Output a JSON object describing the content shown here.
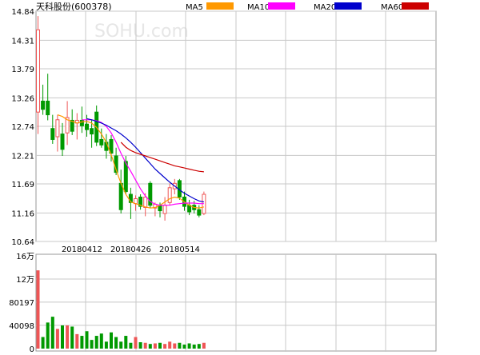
{
  "header": {
    "title": "天科股份(600378)",
    "watermark": "SOHU.com"
  },
  "colors": {
    "up": "#ee5555",
    "down": "#009900",
    "grid": "#c8c8c8",
    "frame": "#999999"
  },
  "chart_data": [
    {
      "type": "candlestick",
      "title": "天科股份(600378)",
      "ylim": [
        10.64,
        14.84
      ],
      "yticks": [
        "14.84",
        "14.31",
        "13.79",
        "13.26",
        "12.74",
        "12.21",
        "11.69",
        "11.16",
        "10.64"
      ],
      "xticks": [
        {
          "index": 9,
          "label": "20180412"
        },
        {
          "index": 19,
          "label": "20180426"
        },
        {
          "index": 29,
          "label": "20180514"
        }
      ],
      "grid": true,
      "legend_position": "top",
      "ma_series": [
        {
          "name": "MA5",
          "color": "#ff9900",
          "values": [
            null,
            null,
            null,
            null,
            12.95,
            12.92,
            12.86,
            12.83,
            12.8,
            12.82,
            12.83,
            12.8,
            12.72,
            12.6,
            12.45,
            12.22,
            11.95,
            11.7,
            11.5,
            11.36,
            11.33,
            11.3,
            11.27,
            11.25,
            11.26,
            11.3,
            11.36,
            11.42,
            11.45,
            11.43,
            11.36,
            11.3,
            11.26,
            11.25,
            11.27
          ]
        },
        {
          "name": "MA10",
          "color": "#ff00ff",
          "values": [
            null,
            null,
            null,
            null,
            null,
            null,
            null,
            null,
            null,
            12.86,
            12.86,
            12.86,
            12.84,
            12.81,
            12.74,
            12.62,
            12.45,
            12.25,
            12.07,
            11.92,
            11.76,
            11.6,
            11.47,
            11.37,
            11.32,
            11.3,
            11.3,
            11.3,
            11.32,
            11.33,
            11.34,
            11.34,
            11.34,
            11.33,
            11.33
          ]
        },
        {
          "name": "MA20",
          "color": "#0000cc",
          "values": [
            null,
            null,
            null,
            null,
            null,
            null,
            null,
            null,
            null,
            null,
            12.88,
            12.86,
            12.83,
            12.8,
            12.76,
            12.71,
            12.66,
            12.6,
            12.53,
            12.45,
            12.36,
            12.26,
            12.16,
            12.06,
            11.96,
            11.88,
            11.8,
            11.72,
            11.65,
            11.58,
            11.52,
            11.47,
            11.42,
            11.38,
            11.36
          ]
        },
        {
          "name": "MA60",
          "color": "#cc0000",
          "values": [
            null,
            null,
            null,
            null,
            null,
            null,
            null,
            null,
            null,
            null,
            null,
            null,
            null,
            null,
            null,
            null,
            null,
            12.45,
            12.36,
            12.3,
            12.26,
            12.23,
            12.2,
            12.17,
            12.14,
            12.11,
            12.08,
            12.05,
            12.02,
            12.0,
            11.98,
            11.96,
            11.94,
            11.92,
            11.91
          ]
        }
      ],
      "ohlc": [
        {
          "o": 13.0,
          "h": 14.75,
          "l": 12.6,
          "c": 14.5
        },
        {
          "o": 13.2,
          "h": 13.5,
          "l": 12.95,
          "c": 13.05
        },
        {
          "o": 13.2,
          "h": 13.7,
          "l": 12.85,
          "c": 12.95
        },
        {
          "o": 12.7,
          "h": 12.95,
          "l": 12.42,
          "c": 12.5
        },
        {
          "o": 12.55,
          "h": 12.95,
          "l": 12.28,
          "c": 12.86
        },
        {
          "o": 12.6,
          "h": 12.8,
          "l": 12.2,
          "c": 12.32
        },
        {
          "o": 12.62,
          "h": 13.2,
          "l": 12.4,
          "c": 12.9
        },
        {
          "o": 12.85,
          "h": 13.05,
          "l": 12.58,
          "c": 12.65
        },
        {
          "o": 12.8,
          "h": 12.98,
          "l": 12.5,
          "c": 12.85
        },
        {
          "o": 12.85,
          "h": 13.1,
          "l": 12.62,
          "c": 12.75
        },
        {
          "o": 12.78,
          "h": 12.95,
          "l": 12.55,
          "c": 12.68
        },
        {
          "o": 12.7,
          "h": 12.85,
          "l": 12.35,
          "c": 12.6
        },
        {
          "o": 13.0,
          "h": 13.12,
          "l": 12.38,
          "c": 12.45
        },
        {
          "o": 12.5,
          "h": 12.7,
          "l": 12.35,
          "c": 12.4
        },
        {
          "o": 12.45,
          "h": 12.6,
          "l": 12.15,
          "c": 12.3
        },
        {
          "o": 12.5,
          "h": 12.58,
          "l": 12.1,
          "c": 12.25
        },
        {
          "o": 12.2,
          "h": 12.35,
          "l": 11.85,
          "c": 11.9
        },
        {
          "o": 11.7,
          "h": 11.95,
          "l": 11.15,
          "c": 11.22
        },
        {
          "o": 12.1,
          "h": 12.2,
          "l": 11.5,
          "c": 11.55
        },
        {
          "o": 11.5,
          "h": 11.62,
          "l": 11.05,
          "c": 11.35
        },
        {
          "o": 11.33,
          "h": 11.48,
          "l": 11.2,
          "c": 11.42
        },
        {
          "o": 11.45,
          "h": 11.5,
          "l": 11.22,
          "c": 11.28
        },
        {
          "o": 11.26,
          "h": 11.52,
          "l": 11.1,
          "c": 11.45
        },
        {
          "o": 11.7,
          "h": 11.74,
          "l": 11.25,
          "c": 11.3
        },
        {
          "o": 11.25,
          "h": 11.35,
          "l": 11.1,
          "c": 11.32
        },
        {
          "o": 11.3,
          "h": 11.35,
          "l": 11.08,
          "c": 11.2
        },
        {
          "o": 11.15,
          "h": 11.45,
          "l": 11.02,
          "c": 11.3
        },
        {
          "o": 11.35,
          "h": 11.7,
          "l": 11.3,
          "c": 11.62
        },
        {
          "o": 11.6,
          "h": 11.78,
          "l": 11.5,
          "c": 11.7
        },
        {
          "o": 11.75,
          "h": 11.78,
          "l": 11.4,
          "c": 11.45
        },
        {
          "o": 11.45,
          "h": 11.55,
          "l": 11.2,
          "c": 11.28
        },
        {
          "o": 11.3,
          "h": 11.4,
          "l": 11.12,
          "c": 11.18
        },
        {
          "o": 11.3,
          "h": 11.38,
          "l": 11.15,
          "c": 11.22
        },
        {
          "o": 11.22,
          "h": 11.3,
          "l": 11.08,
          "c": 11.12
        },
        {
          "o": 11.15,
          "h": 11.55,
          "l": 11.12,
          "c": 11.5
        }
      ]
    },
    {
      "type": "bar",
      "title": "",
      "ylim": [
        0,
        160000
      ],
      "yticks": [
        {
          "value": 160000,
          "label": "16万"
        },
        {
          "value": 120000,
          "label": "12万"
        },
        {
          "value": 80197,
          "label": "80197"
        },
        {
          "value": 40098,
          "label": "40098"
        },
        {
          "value": 0,
          "label": "0"
        }
      ],
      "values": [
        135000,
        20000,
        45000,
        55000,
        34000,
        40000,
        40000,
        38000,
        25000,
        22000,
        30000,
        15000,
        22000,
        26000,
        12000,
        28000,
        20000,
        12000,
        22000,
        10000,
        20000,
        11000,
        10000,
        8000,
        9000,
        10000,
        8000,
        12000,
        9000,
        10000,
        7000,
        9000,
        7000,
        8000,
        10000
      ]
    }
  ]
}
